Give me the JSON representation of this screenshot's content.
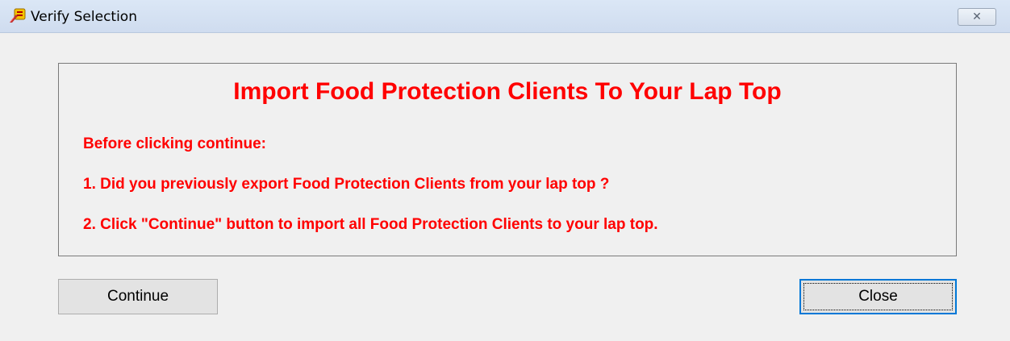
{
  "window": {
    "title": "Verify Selection",
    "close_glyph": "✕"
  },
  "content": {
    "heading": "Import Food Protection Clients To Your Lap Top",
    "lines": [
      "Before clicking continue:",
      "1. Did you previously export Food Protection Clients from your lap top ?",
      "2. Click \"Continue\" button to import all Food Protection Clients to your lap top."
    ],
    "text_color": "#ff0000"
  },
  "buttons": {
    "continue_label": "Continue",
    "close_label": "Close"
  }
}
